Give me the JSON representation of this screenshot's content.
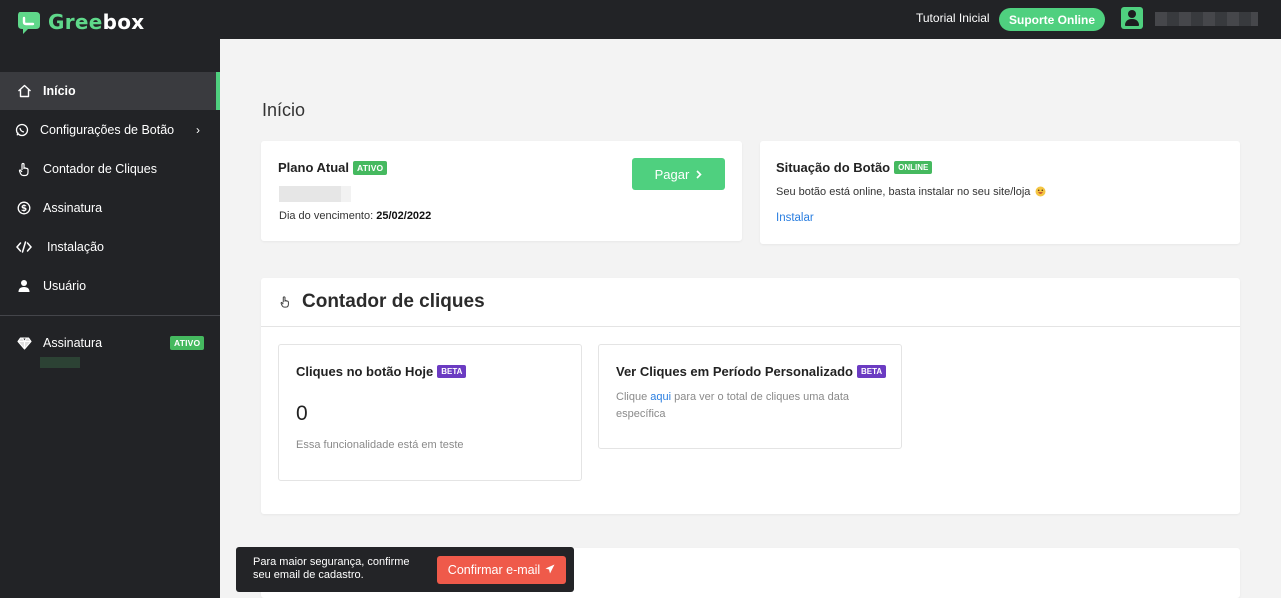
{
  "app": {
    "logo_part1": "Gree",
    "logo_part2": "box",
    "accent_color": "#4fd07f"
  },
  "topbar": {
    "tutorial_label": "Tutorial Inicial",
    "support_label": "Suporte Online"
  },
  "sidebar": {
    "items": [
      {
        "label": "Início",
        "icon": "home-icon"
      },
      {
        "label": "Configurações de Botão",
        "icon": "whatsapp-icon"
      },
      {
        "label": "Contador de Cliques",
        "icon": "pointer-hand-icon"
      },
      {
        "label": "Assinatura",
        "icon": "dollar-icon"
      },
      {
        "label": "Instalação",
        "icon": "code-icon"
      },
      {
        "label": "Usuário",
        "icon": "user-icon"
      }
    ],
    "subscription": {
      "label": "Assinatura",
      "badge": "ATIVO",
      "icon": "diamond-icon"
    }
  },
  "main": {
    "page_title": "Início",
    "plan_card": {
      "title": "Plano Atual",
      "badge": "ATIVO",
      "due_label": "Dia do vencimento:",
      "due_date": "25/02/2022",
      "pay_button": "Pagar"
    },
    "status_card": {
      "title": "Situação do Botão",
      "badge": "ONLINE",
      "message": "Seu botão está online, basta instalar no seu site/loja",
      "install_link": "Instalar"
    },
    "click_counter": {
      "title": "Contador de cliques",
      "today": {
        "title": "Cliques no botão Hoje",
        "badge": "BETA",
        "value": "0",
        "note": "Essa funcionalidade está em teste"
      },
      "custom_period": {
        "title": "Ver Cliques em Período Personalizado",
        "badge": "BETA",
        "text_before": "Clique",
        "link": "aqui",
        "text_after": "para ver o total de cliques uma data específica"
      }
    }
  },
  "toast": {
    "message": "Para maior segurança, confirme seu email de cadastro.",
    "button": "Confirmar e-mail"
  }
}
